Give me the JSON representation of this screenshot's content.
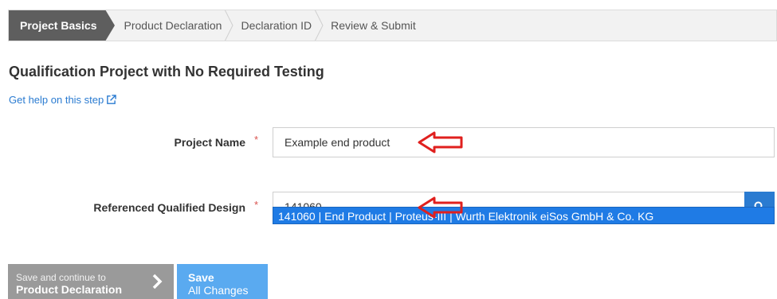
{
  "wizard": {
    "steps": [
      {
        "label": "Project Basics",
        "active": true
      },
      {
        "label": "Product Declaration",
        "active": false
      },
      {
        "label": "Declaration ID",
        "active": false
      },
      {
        "label": "Review & Submit",
        "active": false
      }
    ]
  },
  "page": {
    "title": "Qualification Project with No Required Testing",
    "help_link": "Get help on this step"
  },
  "form": {
    "project_name_label": "Project Name",
    "project_name_value": "Example end product",
    "referenced_design_label": "Referenced Qualified Design",
    "referenced_design_value": "141060",
    "required_marker": "*",
    "suggestion": "141060 | End Product | Proteus-III | Wurth Elektronik eiSos GmbH & Co. KG"
  },
  "actions": {
    "save_continue_small": "Save and continue to",
    "save_continue_big": "Product Declaration",
    "save_all_top": "Save",
    "save_all_bottom": "All Changes"
  },
  "colors": {
    "accent": "#2a7bd1",
    "active_step": "#5e5e5e",
    "highlight": "#1f7be5",
    "annotation_arrow": "#e0201e",
    "required": "#d9534f"
  },
  "icons": {
    "help": "external-link-icon",
    "search": "search-icon",
    "continue": "chevron-right-icon"
  }
}
